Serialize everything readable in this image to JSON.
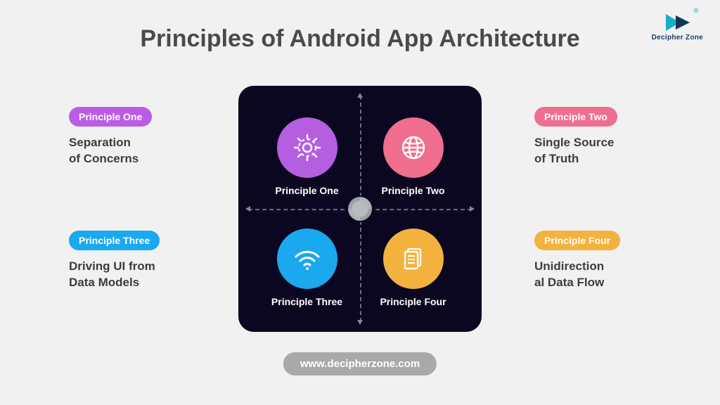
{
  "title": "Principles of Android App Architecture",
  "brand": {
    "name": "Decipher Zone",
    "reg": "®"
  },
  "url": "www.decipherzone.com",
  "panel": {
    "q1": {
      "label": "Principle One",
      "icon": "gear-icon",
      "color": "purple"
    },
    "q2": {
      "label": "Principle Two",
      "icon": "globe-icon",
      "color": "pink"
    },
    "q3": {
      "label": "Principle Three",
      "icon": "wifi-icon",
      "color": "blue"
    },
    "q4": {
      "label": "Principle Four",
      "icon": "document-icon",
      "color": "amber"
    }
  },
  "callouts": {
    "one": {
      "pill": "Principle One",
      "desc": "Separation\nof Concerns"
    },
    "two": {
      "pill": "Principle Two",
      "desc": "Single Source\nof Truth"
    },
    "three": {
      "pill": "Principle Three",
      "desc": "Driving UI from\nData Models"
    },
    "four": {
      "pill": "Principle Four",
      "desc": "Unidirection\nal Data Flow"
    }
  }
}
